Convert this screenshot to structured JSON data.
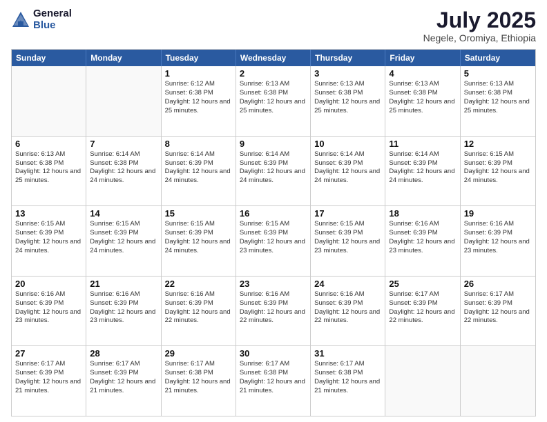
{
  "logo": {
    "general": "General",
    "blue": "Blue"
  },
  "title": {
    "month_year": "July 2025",
    "location": "Negele, Oromiya, Ethiopia"
  },
  "header_days": [
    "Sunday",
    "Monday",
    "Tuesday",
    "Wednesday",
    "Thursday",
    "Friday",
    "Saturday"
  ],
  "weeks": [
    [
      {
        "day": "",
        "info": ""
      },
      {
        "day": "",
        "info": ""
      },
      {
        "day": "1",
        "info": "Sunrise: 6:12 AM\nSunset: 6:38 PM\nDaylight: 12 hours and 25 minutes."
      },
      {
        "day": "2",
        "info": "Sunrise: 6:13 AM\nSunset: 6:38 PM\nDaylight: 12 hours and 25 minutes."
      },
      {
        "day": "3",
        "info": "Sunrise: 6:13 AM\nSunset: 6:38 PM\nDaylight: 12 hours and 25 minutes."
      },
      {
        "day": "4",
        "info": "Sunrise: 6:13 AM\nSunset: 6:38 PM\nDaylight: 12 hours and 25 minutes."
      },
      {
        "day": "5",
        "info": "Sunrise: 6:13 AM\nSunset: 6:38 PM\nDaylight: 12 hours and 25 minutes."
      }
    ],
    [
      {
        "day": "6",
        "info": "Sunrise: 6:13 AM\nSunset: 6:38 PM\nDaylight: 12 hours and 25 minutes."
      },
      {
        "day": "7",
        "info": "Sunrise: 6:14 AM\nSunset: 6:38 PM\nDaylight: 12 hours and 24 minutes."
      },
      {
        "day": "8",
        "info": "Sunrise: 6:14 AM\nSunset: 6:39 PM\nDaylight: 12 hours and 24 minutes."
      },
      {
        "day": "9",
        "info": "Sunrise: 6:14 AM\nSunset: 6:39 PM\nDaylight: 12 hours and 24 minutes."
      },
      {
        "day": "10",
        "info": "Sunrise: 6:14 AM\nSunset: 6:39 PM\nDaylight: 12 hours and 24 minutes."
      },
      {
        "day": "11",
        "info": "Sunrise: 6:14 AM\nSunset: 6:39 PM\nDaylight: 12 hours and 24 minutes."
      },
      {
        "day": "12",
        "info": "Sunrise: 6:15 AM\nSunset: 6:39 PM\nDaylight: 12 hours and 24 minutes."
      }
    ],
    [
      {
        "day": "13",
        "info": "Sunrise: 6:15 AM\nSunset: 6:39 PM\nDaylight: 12 hours and 24 minutes."
      },
      {
        "day": "14",
        "info": "Sunrise: 6:15 AM\nSunset: 6:39 PM\nDaylight: 12 hours and 24 minutes."
      },
      {
        "day": "15",
        "info": "Sunrise: 6:15 AM\nSunset: 6:39 PM\nDaylight: 12 hours and 24 minutes."
      },
      {
        "day": "16",
        "info": "Sunrise: 6:15 AM\nSunset: 6:39 PM\nDaylight: 12 hours and 23 minutes."
      },
      {
        "day": "17",
        "info": "Sunrise: 6:15 AM\nSunset: 6:39 PM\nDaylight: 12 hours and 23 minutes."
      },
      {
        "day": "18",
        "info": "Sunrise: 6:16 AM\nSunset: 6:39 PM\nDaylight: 12 hours and 23 minutes."
      },
      {
        "day": "19",
        "info": "Sunrise: 6:16 AM\nSunset: 6:39 PM\nDaylight: 12 hours and 23 minutes."
      }
    ],
    [
      {
        "day": "20",
        "info": "Sunrise: 6:16 AM\nSunset: 6:39 PM\nDaylight: 12 hours and 23 minutes."
      },
      {
        "day": "21",
        "info": "Sunrise: 6:16 AM\nSunset: 6:39 PM\nDaylight: 12 hours and 23 minutes."
      },
      {
        "day": "22",
        "info": "Sunrise: 6:16 AM\nSunset: 6:39 PM\nDaylight: 12 hours and 22 minutes."
      },
      {
        "day": "23",
        "info": "Sunrise: 6:16 AM\nSunset: 6:39 PM\nDaylight: 12 hours and 22 minutes."
      },
      {
        "day": "24",
        "info": "Sunrise: 6:16 AM\nSunset: 6:39 PM\nDaylight: 12 hours and 22 minutes."
      },
      {
        "day": "25",
        "info": "Sunrise: 6:17 AM\nSunset: 6:39 PM\nDaylight: 12 hours and 22 minutes."
      },
      {
        "day": "26",
        "info": "Sunrise: 6:17 AM\nSunset: 6:39 PM\nDaylight: 12 hours and 22 minutes."
      }
    ],
    [
      {
        "day": "27",
        "info": "Sunrise: 6:17 AM\nSunset: 6:39 PM\nDaylight: 12 hours and 21 minutes."
      },
      {
        "day": "28",
        "info": "Sunrise: 6:17 AM\nSunset: 6:39 PM\nDaylight: 12 hours and 21 minutes."
      },
      {
        "day": "29",
        "info": "Sunrise: 6:17 AM\nSunset: 6:38 PM\nDaylight: 12 hours and 21 minutes."
      },
      {
        "day": "30",
        "info": "Sunrise: 6:17 AM\nSunset: 6:38 PM\nDaylight: 12 hours and 21 minutes."
      },
      {
        "day": "31",
        "info": "Sunrise: 6:17 AM\nSunset: 6:38 PM\nDaylight: 12 hours and 21 minutes."
      },
      {
        "day": "",
        "info": ""
      },
      {
        "day": "",
        "info": ""
      }
    ]
  ]
}
